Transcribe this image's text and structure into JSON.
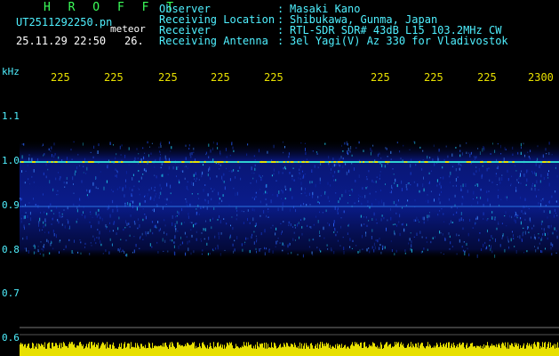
{
  "header": {
    "brand": "H R O F F T",
    "file_name": "UT2511292250.pn",
    "mode": "meteor",
    "datetime": "25.11.29 22:50",
    "duration": "26."
  },
  "info": [
    {
      "label": "Observer",
      "value": "Masaki Kano"
    },
    {
      "label": "Receiving Location",
      "value": "Shibukawa, Gunma, Japan"
    },
    {
      "label": "Receiver",
      "value": "RTL-SDR SDR# 43dB L15 103.2MHz CW"
    },
    {
      "label": "Receiving Antenna",
      "value": "3el Yagi(V) Az 330 for Vladivostok"
    }
  ],
  "separator": ":",
  "axis": {
    "unit": "kHz",
    "y_ticks": [
      "1.1",
      "1.0",
      "0.9",
      "0.8",
      "0.7",
      "0.6"
    ],
    "x_ticks": [
      "225",
      "225",
      "225",
      "225",
      "225",
      "225",
      "225",
      "225",
      "2300"
    ]
  },
  "colors": {
    "label_text": "#4ff0ff",
    "value_text": "#ffffff",
    "tick_text": "#e8e000",
    "brand_text": "#3cff5a",
    "echo_trace": "#e8e000",
    "noise_base": "#0a1a8a"
  }
}
